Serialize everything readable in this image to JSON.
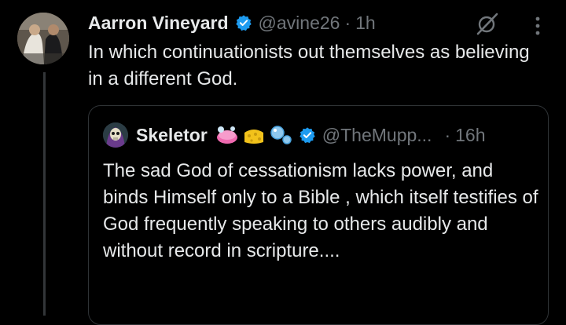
{
  "tweet": {
    "author_name": "Aarron Vineyard",
    "handle": "@avine26",
    "separator": "·",
    "time": "1h",
    "text": "In which continuationists out themselves as believing in a different God."
  },
  "quote": {
    "author_name": "Skeletor",
    "handle": "@TheMupp...",
    "separator": "·",
    "time": "16h",
    "text": "The sad God of cessationism lacks power, and binds Himself only to a Bible , which itself testifies of God frequently speaking to others audibly and without record in scripture....",
    "emojis": [
      "soap-icon",
      "sponge-icon",
      "bubbles-icon"
    ]
  },
  "colors": {
    "background": "#000000",
    "text": "#e7e9ea",
    "muted": "#71767b",
    "verified": "#1d9bf0",
    "border": "#2f3336"
  }
}
